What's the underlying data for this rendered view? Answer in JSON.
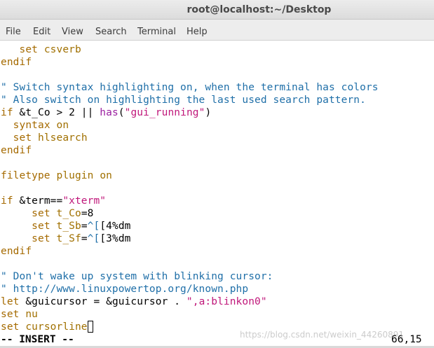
{
  "window": {
    "title": "root@localhost:~/Desktop"
  },
  "menu": {
    "items": [
      "File",
      "Edit",
      "View",
      "Search",
      "Terminal",
      "Help"
    ]
  },
  "editor": {
    "lines": [
      [
        {
          "t": "   "
        },
        {
          "t": "set",
          "c": "k"
        },
        {
          "t": " "
        },
        {
          "t": "csverb",
          "c": "o"
        }
      ],
      [
        {
          "t": "endif",
          "c": "k"
        }
      ],
      [
        {
          "t": ""
        }
      ],
      [
        {
          "t": "\" Switch syntax highlighting on, when the terminal has colors",
          "c": "c"
        }
      ],
      [
        {
          "t": "\" Also switch on highlighting the last used search pattern.",
          "c": "c"
        }
      ],
      [
        {
          "t": "if",
          "c": "k"
        },
        {
          "t": " &t_Co > 2 || "
        },
        {
          "t": "has",
          "c": "f"
        },
        {
          "t": "("
        },
        {
          "t": "\"gui_running\"",
          "c": "s"
        },
        {
          "t": ")"
        }
      ],
      [
        {
          "t": "  "
        },
        {
          "t": "syntax",
          "c": "k"
        },
        {
          "t": " "
        },
        {
          "t": "on",
          "c": "o"
        }
      ],
      [
        {
          "t": "  "
        },
        {
          "t": "set",
          "c": "k"
        },
        {
          "t": " "
        },
        {
          "t": "hlsearch",
          "c": "o"
        }
      ],
      [
        {
          "t": "endif",
          "c": "k"
        }
      ],
      [
        {
          "t": ""
        }
      ],
      [
        {
          "t": "filetype",
          "c": "k"
        },
        {
          "t": " "
        },
        {
          "t": "plugin",
          "c": "o"
        },
        {
          "t": " "
        },
        {
          "t": "on",
          "c": "o"
        }
      ],
      [
        {
          "t": ""
        }
      ],
      [
        {
          "t": "if",
          "c": "k"
        },
        {
          "t": " &term=="
        },
        {
          "t": "\"xterm\"",
          "c": "s"
        }
      ],
      [
        {
          "t": "     "
        },
        {
          "t": "set",
          "c": "k"
        },
        {
          "t": " "
        },
        {
          "t": "t_Co",
          "c": "o"
        },
        {
          "t": "=8"
        }
      ],
      [
        {
          "t": "     "
        },
        {
          "t": "set",
          "c": "k"
        },
        {
          "t": " "
        },
        {
          "t": "t_Sb",
          "c": "o"
        },
        {
          "t": "="
        },
        {
          "t": "^[",
          "c": "c"
        },
        {
          "t": "[4%dm"
        }
      ],
      [
        {
          "t": "     "
        },
        {
          "t": "set",
          "c": "k"
        },
        {
          "t": " "
        },
        {
          "t": "t_Sf",
          "c": "o"
        },
        {
          "t": "="
        },
        {
          "t": "^[",
          "c": "c"
        },
        {
          "t": "[3%dm"
        }
      ],
      [
        {
          "t": "endif",
          "c": "k"
        }
      ],
      [
        {
          "t": ""
        }
      ],
      [
        {
          "t": "\" Don't wake up system with blinking cursor:",
          "c": "c"
        }
      ],
      [
        {
          "t": "\" http://www.linuxpowertop.org/known.php",
          "c": "c"
        }
      ],
      [
        {
          "t": "let",
          "c": "k"
        },
        {
          "t": " &guicursor = &guicursor . "
        },
        {
          "t": "\",a:blinkon0\"",
          "c": "s"
        }
      ],
      [
        {
          "t": "set",
          "c": "k"
        },
        {
          "t": " "
        },
        {
          "t": "nu",
          "c": "o"
        }
      ],
      [
        {
          "t": "set",
          "c": "k"
        },
        {
          "t": " "
        },
        {
          "t": "cursorline",
          "c": "o"
        },
        {
          "cursor": true
        }
      ]
    ]
  },
  "status": {
    "mode": "-- INSERT --",
    "position": "66,15"
  },
  "watermark": "https://blog.csdn.net/weixin_44260891"
}
